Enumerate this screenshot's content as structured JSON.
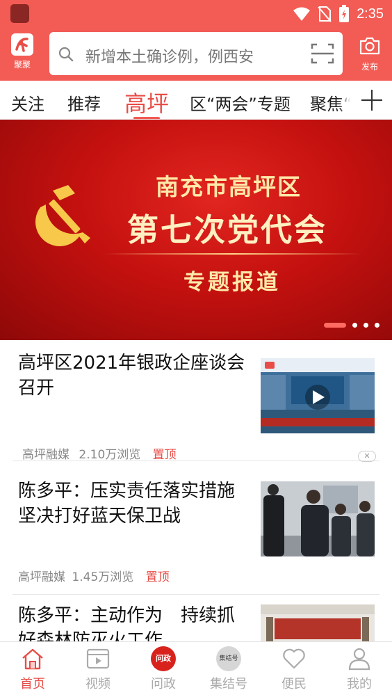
{
  "status_bar": {
    "time": "2:35"
  },
  "header": {
    "logo_label": "聚聚",
    "search_placeholder": "新增本土确诊例，例西安",
    "publish_label": "发布"
  },
  "tabs": [
    {
      "label": "关注"
    },
    {
      "label": "推荐"
    },
    {
      "label": "高坪",
      "active": true
    },
    {
      "label": "区“两会”专题"
    },
    {
      "label": "聚焦“"
    }
  ],
  "banner": {
    "line1": "南充市高坪区",
    "line2": "第七次党代会",
    "line3": "专题报道",
    "slides_total": 4,
    "active_slide": 1
  },
  "news": [
    {
      "title": "高坪区2021年银政企座谈会召开",
      "source": "高坪融媒",
      "views": "2.10万浏览",
      "pinned": "置顶",
      "thumb_caption": "高坪区2021年银政企座谈会召开",
      "has_video": true
    },
    {
      "title": "陈多平：压实责任落实措施 坚决打好蓝天保卫战",
      "source": "高坪融媒",
      "views": "1.45万浏览",
      "pinned": "置顶"
    },
    {
      "title": "陈多平：主动作为　持续抓好森林防灭火工作"
    }
  ],
  "bottom_nav": [
    {
      "label": "首页",
      "active": true
    },
    {
      "label": "视频"
    },
    {
      "label": "问政",
      "badge_text": "问政"
    },
    {
      "label": "集结号",
      "badge_text": "集结号"
    },
    {
      "label": "便民"
    },
    {
      "label": "我的"
    }
  ],
  "colors": {
    "brand": "#f25c55",
    "accent_text": "#e84d47"
  }
}
